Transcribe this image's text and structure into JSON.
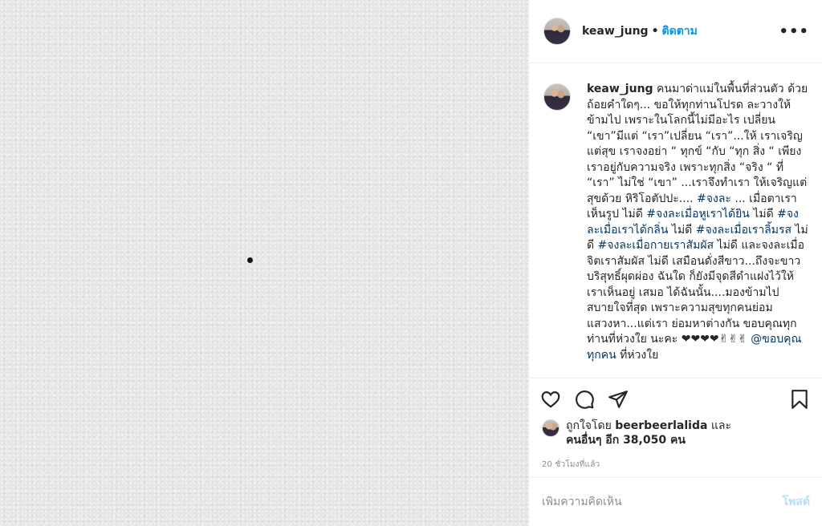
{
  "post": {
    "username": "keaw_jung",
    "separator": "•",
    "follow_label": "ติดตาม",
    "more_label": "•••"
  },
  "caption": {
    "username": "keaw_jung",
    "segments": [
      {
        "type": "text",
        "text": " คนมาด่าแม่ในพื้นที่ส่วนตัว ด้วยถ้อยคำใดๆ... ขอให้ทุกท่านโปรด ละวางให้ข้ามไป เพราะในโลกนี้ไม่มีอะไร เปลี่ยน “เขา”มีแต่ “เรา”เปลี่ยน “เรา”...ให้ เราเจริญแต่สุข เราจงอย่า “ ทุกข์ “กับ “ทุก สิ่ง “ เพียงเราอยู่กับความจริง เพราะทุกสิ่ง “จริง “ ที่ “เรา” ไม่ใช่ “เขา” ...เราจึงทำเรา ให้เจริญแต่สุขด้วย หิริโอตัปปะ.... "
      },
      {
        "type": "tag",
        "text": "#จงละ"
      },
      {
        "type": "text",
        "text": " ... เมื่อตาเราเห็นรูป ไม่ดี "
      },
      {
        "type": "tag",
        "text": "#จงละเมื่อหูเราได้ยิน"
      },
      {
        "type": "text",
        "text": " ไม่ดี "
      },
      {
        "type": "tag",
        "text": "#จงละเมื่อเราได้กลิ่น"
      },
      {
        "type": "text",
        "text": " ไม่ดี "
      },
      {
        "type": "tag",
        "text": "#จงละเมื่อเราลิ้มรส"
      },
      {
        "type": "text",
        "text": " ไม่ดี "
      },
      {
        "type": "tag",
        "text": "#จงละเมื่อกายเราสัมผัส"
      },
      {
        "type": "text",
        "text": " ไม่ดี และจงละเมื่อจิตเราสัมผัส ไม่ดี เสมือนดั่งสีขาว...ถึงจะขาวบริสุทธิ์ผุดผ่อง ฉันใด ก็ยังมีจุดสีดำแฝงไว้ให้เราเห็นอยู่ เสมอ ได้ฉันนั้น....มองข้ามไปสบายใจที่สุด เพราะความสุขทุกคนย่อมแสวงหา...แต่เรา ย่อมหาต่างกัน ขอบคุณทุกท่านที่ห่วงใย นะคะ ❤❤❤❤✌✌✌ "
      },
      {
        "type": "tag",
        "text": "@ขอบคุณทุกคน"
      },
      {
        "type": "text",
        "text": " ที่ห่วงใย"
      }
    ]
  },
  "likes": {
    "prefix": "ถูกใจโดย",
    "user": "beerbeerlalida",
    "and": "และ",
    "others": "คนอื่นๆ อีก 38,050 คน"
  },
  "timestamp": "20 ชั่วโมงที่แล้ว",
  "comment": {
    "placeholder": "เพิ่มความคิดเห็น",
    "post_label": "โพสต์"
  },
  "icons": {
    "like": "heart-icon",
    "comment": "comment-icon",
    "share": "share-icon",
    "save": "bookmark-icon"
  }
}
